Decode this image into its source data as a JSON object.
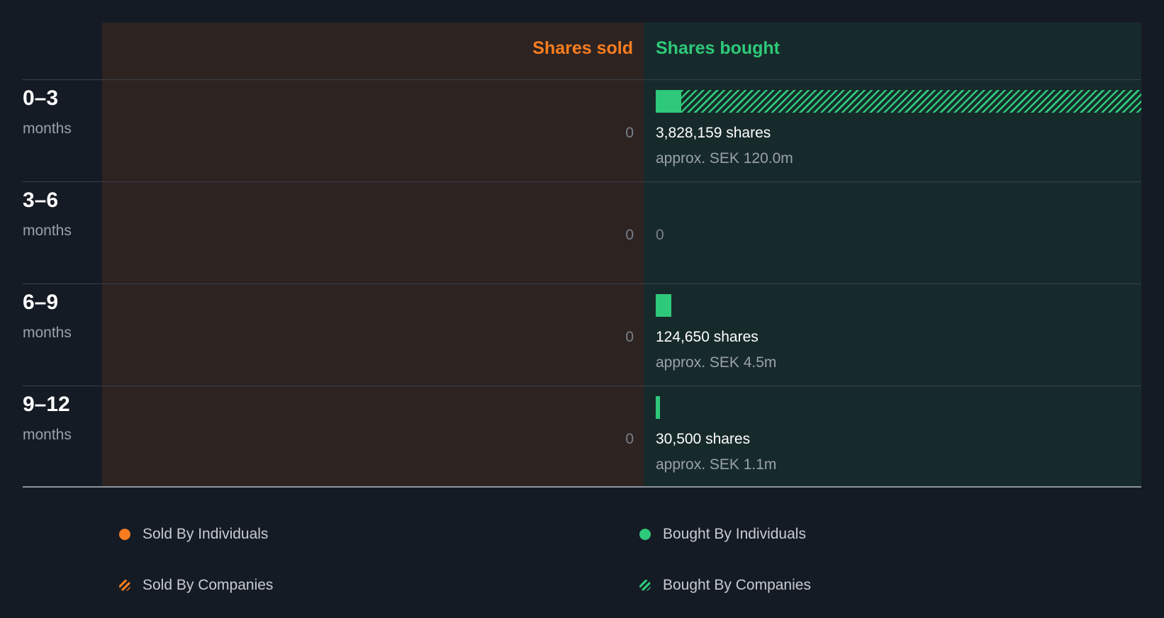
{
  "chart_data": {
    "type": "bar",
    "headers": {
      "sold": "Shares sold",
      "bought": "Shares bought"
    },
    "unit_label": "months",
    "categories": [
      "0–3",
      "3–6",
      "6–9",
      "9–12"
    ],
    "sold_values": [
      0,
      0,
      0,
      0
    ],
    "sold_labels": [
      "0",
      "0",
      "0",
      "0"
    ],
    "series": [
      {
        "name": "Bought By Individuals",
        "values": [
          200000,
          0,
          124650,
          30500
        ]
      },
      {
        "name": "Bought By Companies",
        "values": [
          3628159,
          0,
          0,
          0
        ]
      }
    ],
    "bought_total": [
      3828159,
      0,
      124650,
      30500
    ],
    "bought_shares_labels": [
      "3,828,159 shares",
      "0",
      "124,650 shares",
      "30,500 shares"
    ],
    "bought_approx_labels": [
      "approx. SEK 120.0m",
      "",
      "approx. SEK 4.5m",
      "approx. SEK 1.1m"
    ],
    "xlim": [
      0,
      3828159
    ],
    "colors": {
      "sold": "#f97d1f",
      "bought": "#2ec97a"
    }
  },
  "legend": {
    "sold_individuals": "Sold By Individuals",
    "sold_companies": "Sold By Companies",
    "bought_individuals": "Bought By Individuals",
    "bought_companies": "Bought By Companies"
  }
}
